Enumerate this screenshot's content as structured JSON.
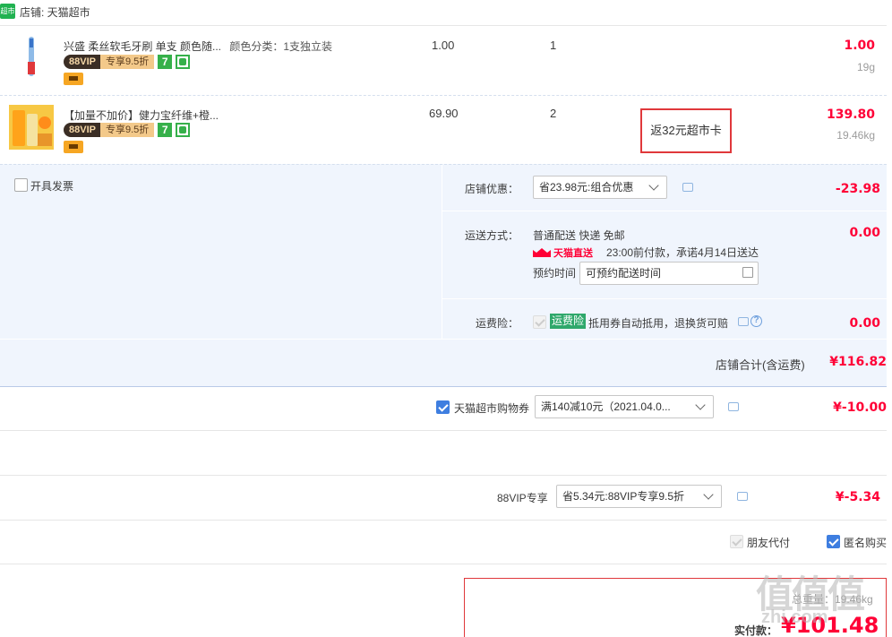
{
  "shop": {
    "logo_text": "超市",
    "label": "店铺: 天猫超市"
  },
  "items": [
    {
      "title": "兴盛 柔丝软毛牙刷 单支 颜色随...",
      "sku": "颜色分类：1支独立装",
      "vip": "88VIP",
      "vip_discount": "专享9.5折",
      "badge": "7",
      "price": "1.00",
      "qty": "1",
      "total": "1.00",
      "weight": "19g"
    },
    {
      "title": "【加量不加价】健力宝纤维+橙...",
      "vip": "88VIP",
      "vip_discount": "专享9.5折",
      "badge": "7",
      "price": "69.90",
      "qty": "2",
      "promo": "返32元超市卡",
      "total": "139.80",
      "weight": "19.46kg"
    }
  ],
  "invoice": {
    "label": "开具发票"
  },
  "shop_discount": {
    "label": "店铺优惠：",
    "selected": "省23.98元:组合优惠",
    "amount": "-23.98"
  },
  "delivery": {
    "label": "运送方式：",
    "method": "普通配送 快递 免邮",
    "tmall_logo": "天猫直送",
    "promise": "23:00前付款，承诺4月14日送达",
    "appoint_label": "预约时间",
    "appoint_placeholder": "可预约配送时间",
    "amount": "0.00"
  },
  "insurance": {
    "label": "运费险：",
    "tag": "运费险",
    "desc": "抵用券自动抵用，退换货可赔",
    "amount": "0.00"
  },
  "shop_total": {
    "label": "店铺合计(含运费)",
    "amount": "¥116.82"
  },
  "coupon": {
    "label": "天猫超市购物券",
    "selected": "满140减10元（2021.04.0...",
    "amount": "¥-10.00"
  },
  "vip88": {
    "label": "88VIP专享",
    "selected": "省5.34元:88VIP专享9.5折",
    "amount": "¥-5.34"
  },
  "options": {
    "friend_pay": "朋友代付",
    "anonymous": "匿名购买"
  },
  "pay": {
    "label": "实付款：",
    "amount": "¥101.48",
    "weight_partial": "总重量：19.46kg"
  },
  "watermark": {
    "logo": "值值值",
    "url": "zhi.com"
  },
  "colors": {
    "accent_red": "#ff0036",
    "panel_bg": "#f0f5fd",
    "tmall_green": "#21b251"
  }
}
